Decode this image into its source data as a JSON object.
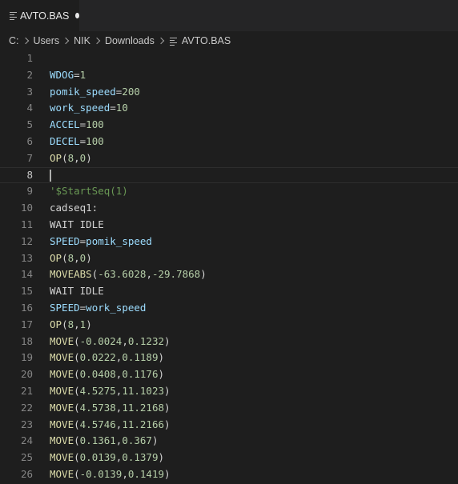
{
  "tab": {
    "title": "AVTO.BAS"
  },
  "breadcrumb": [
    "C:",
    "Users",
    "NIK",
    "Downloads",
    "AVTO.BAS"
  ],
  "lines": [
    {
      "n": "1",
      "tokens": []
    },
    {
      "n": "2",
      "tokens": [
        [
          "var",
          "WDOG"
        ],
        [
          "op",
          "="
        ],
        [
          "num",
          "1"
        ]
      ]
    },
    {
      "n": "3",
      "tokens": [
        [
          "var",
          "pomik_speed"
        ],
        [
          "op",
          "="
        ],
        [
          "num",
          "200"
        ]
      ]
    },
    {
      "n": "4",
      "tokens": [
        [
          "var",
          "work_speed"
        ],
        [
          "op",
          "="
        ],
        [
          "num",
          "10"
        ]
      ]
    },
    {
      "n": "5",
      "tokens": [
        [
          "var",
          "ACCEL"
        ],
        [
          "op",
          "="
        ],
        [
          "num",
          "100"
        ]
      ]
    },
    {
      "n": "6",
      "tokens": [
        [
          "var",
          "DECEL"
        ],
        [
          "op",
          "="
        ],
        [
          "num",
          "100"
        ]
      ]
    },
    {
      "n": "7",
      "tokens": [
        [
          "fn",
          "OP"
        ],
        [
          "op",
          "("
        ],
        [
          "num",
          "8"
        ],
        [
          "op",
          ","
        ],
        [
          "num",
          "0"
        ],
        [
          "op",
          ")"
        ]
      ]
    },
    {
      "n": "8",
      "tokens": [],
      "current": true
    },
    {
      "n": "9",
      "tokens": [
        [
          "cm",
          "'$StartSeq(1)"
        ]
      ]
    },
    {
      "n": "10",
      "tokens": [
        [
          "kw",
          "cadseq1:"
        ]
      ]
    },
    {
      "n": "11",
      "tokens": [
        [
          "kw",
          "WAIT IDLE"
        ]
      ]
    },
    {
      "n": "12",
      "tokens": [
        [
          "var",
          "SPEED"
        ],
        [
          "op",
          "="
        ],
        [
          "var",
          "pomik_speed"
        ]
      ]
    },
    {
      "n": "13",
      "tokens": [
        [
          "fn",
          "OP"
        ],
        [
          "op",
          "("
        ],
        [
          "num",
          "8"
        ],
        [
          "op",
          ","
        ],
        [
          "num",
          "0"
        ],
        [
          "op",
          ")"
        ]
      ]
    },
    {
      "n": "14",
      "tokens": [
        [
          "fn",
          "MOVEABS"
        ],
        [
          "op",
          "("
        ],
        [
          "num",
          "-63.6028"
        ],
        [
          "op",
          ","
        ],
        [
          "num",
          "-29.7868"
        ],
        [
          "op",
          ")"
        ]
      ]
    },
    {
      "n": "15",
      "tokens": [
        [
          "kw",
          "WAIT IDLE"
        ]
      ]
    },
    {
      "n": "16",
      "tokens": [
        [
          "var",
          "SPEED"
        ],
        [
          "op",
          "="
        ],
        [
          "var",
          "work_speed"
        ]
      ]
    },
    {
      "n": "17",
      "tokens": [
        [
          "fn",
          "OP"
        ],
        [
          "op",
          "("
        ],
        [
          "num",
          "8"
        ],
        [
          "op",
          ","
        ],
        [
          "num",
          "1"
        ],
        [
          "op",
          ")"
        ]
      ]
    },
    {
      "n": "18",
      "tokens": [
        [
          "fn",
          "MOVE"
        ],
        [
          "op",
          "("
        ],
        [
          "num",
          "-0.0024"
        ],
        [
          "op",
          ","
        ],
        [
          "num",
          "0.1232"
        ],
        [
          "op",
          ")"
        ]
      ]
    },
    {
      "n": "19",
      "tokens": [
        [
          "fn",
          "MOVE"
        ],
        [
          "op",
          "("
        ],
        [
          "num",
          "0.0222"
        ],
        [
          "op",
          ","
        ],
        [
          "num",
          "0.1189"
        ],
        [
          "op",
          ")"
        ]
      ]
    },
    {
      "n": "20",
      "tokens": [
        [
          "fn",
          "MOVE"
        ],
        [
          "op",
          "("
        ],
        [
          "num",
          "0.0408"
        ],
        [
          "op",
          ","
        ],
        [
          "num",
          "0.1176"
        ],
        [
          "op",
          ")"
        ]
      ]
    },
    {
      "n": "21",
      "tokens": [
        [
          "fn",
          "MOVE"
        ],
        [
          "op",
          "("
        ],
        [
          "num",
          "4.5275"
        ],
        [
          "op",
          ","
        ],
        [
          "num",
          "11.1023"
        ],
        [
          "op",
          ")"
        ]
      ]
    },
    {
      "n": "22",
      "tokens": [
        [
          "fn",
          "MOVE"
        ],
        [
          "op",
          "("
        ],
        [
          "num",
          "4.5738"
        ],
        [
          "op",
          ","
        ],
        [
          "num",
          "11.2168"
        ],
        [
          "op",
          ")"
        ]
      ]
    },
    {
      "n": "23",
      "tokens": [
        [
          "fn",
          "MOVE"
        ],
        [
          "op",
          "("
        ],
        [
          "num",
          "4.5746"
        ],
        [
          "op",
          ","
        ],
        [
          "num",
          "11.2166"
        ],
        [
          "op",
          ")"
        ]
      ]
    },
    {
      "n": "24",
      "tokens": [
        [
          "fn",
          "MOVE"
        ],
        [
          "op",
          "("
        ],
        [
          "num",
          "0.1361"
        ],
        [
          "op",
          ","
        ],
        [
          "num",
          "0.367"
        ],
        [
          "op",
          ")"
        ]
      ]
    },
    {
      "n": "25",
      "tokens": [
        [
          "fn",
          "MOVE"
        ],
        [
          "op",
          "("
        ],
        [
          "num",
          "0.0139"
        ],
        [
          "op",
          ","
        ],
        [
          "num",
          "0.1379"
        ],
        [
          "op",
          ")"
        ]
      ]
    },
    {
      "n": "26",
      "tokens": [
        [
          "fn",
          "MOVE"
        ],
        [
          "op",
          "("
        ],
        [
          "num",
          "-0.0139"
        ],
        [
          "op",
          ","
        ],
        [
          "num",
          "0.1419"
        ],
        [
          "op",
          ")"
        ]
      ]
    }
  ]
}
